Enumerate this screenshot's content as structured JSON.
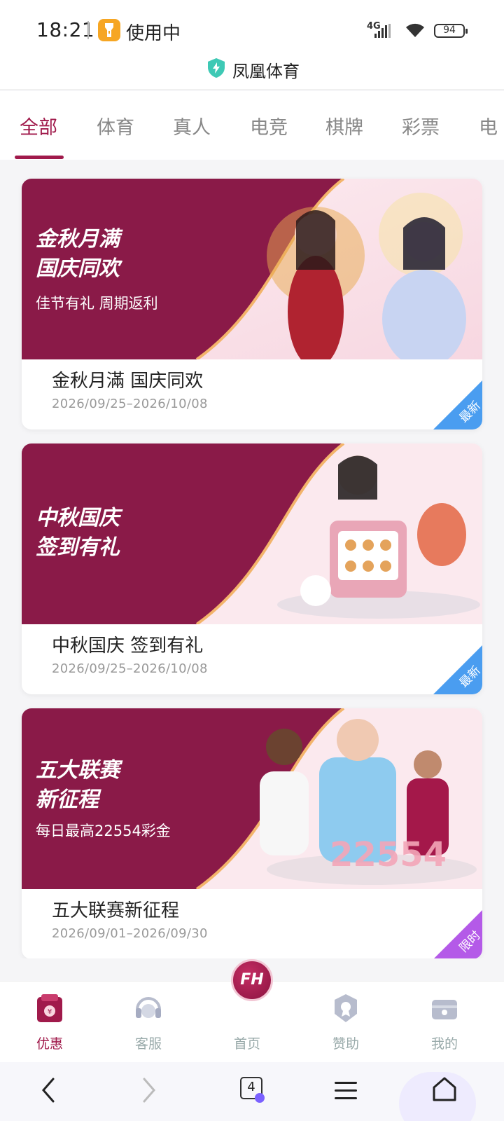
{
  "status_bar": {
    "time": "18:21",
    "activity": "使用中",
    "network": "4G",
    "battery": "94"
  },
  "header": {
    "title": "凤凰体育"
  },
  "tabs": [
    {
      "label": "全部",
      "active": true
    },
    {
      "label": "体育"
    },
    {
      "label": "真人"
    },
    {
      "label": "电竞"
    },
    {
      "label": "棋牌"
    },
    {
      "label": "彩票"
    },
    {
      "label": "电"
    }
  ],
  "promotions": [
    {
      "banner_title": "金秋月满\n国庆同欢",
      "banner_subtitle": "佳节有礼 周期返利",
      "title": "金秋月滿 国庆同欢",
      "date_range": "2026/09/25–2026/10/08",
      "badge": "最新",
      "badge_color": "#4a9df0"
    },
    {
      "banner_title": "中秋国庆\n签到有礼",
      "banner_subtitle": "",
      "title": "中秋国庆 签到有礼",
      "date_range": "2026/09/25–2026/10/08",
      "badge": "最新",
      "badge_color": "#4a9df0"
    },
    {
      "banner_title": "五大联赛\n新征程",
      "banner_subtitle": "每日最高22554彩金",
      "title": "五大联赛新征程",
      "date_range": "2026/09/01–2026/09/30",
      "badge": "限时",
      "badge_color": "#b45ae8"
    }
  ],
  "bottom_nav": [
    {
      "label": "优惠",
      "icon": "gift-bag-icon",
      "active": true
    },
    {
      "label": "客服",
      "icon": "headset-icon"
    },
    {
      "label": "首页",
      "icon": "fh-logo-icon",
      "logo_text": "FH"
    },
    {
      "label": "赞助",
      "icon": "badge-icon"
    },
    {
      "label": "我的",
      "icon": "wallet-icon"
    }
  ],
  "browser": {
    "tab_count": "4"
  },
  "colors": {
    "accent": "#a01a4b",
    "banner_dark": "#8a1a48",
    "banner_light": "#fbe9ee"
  }
}
